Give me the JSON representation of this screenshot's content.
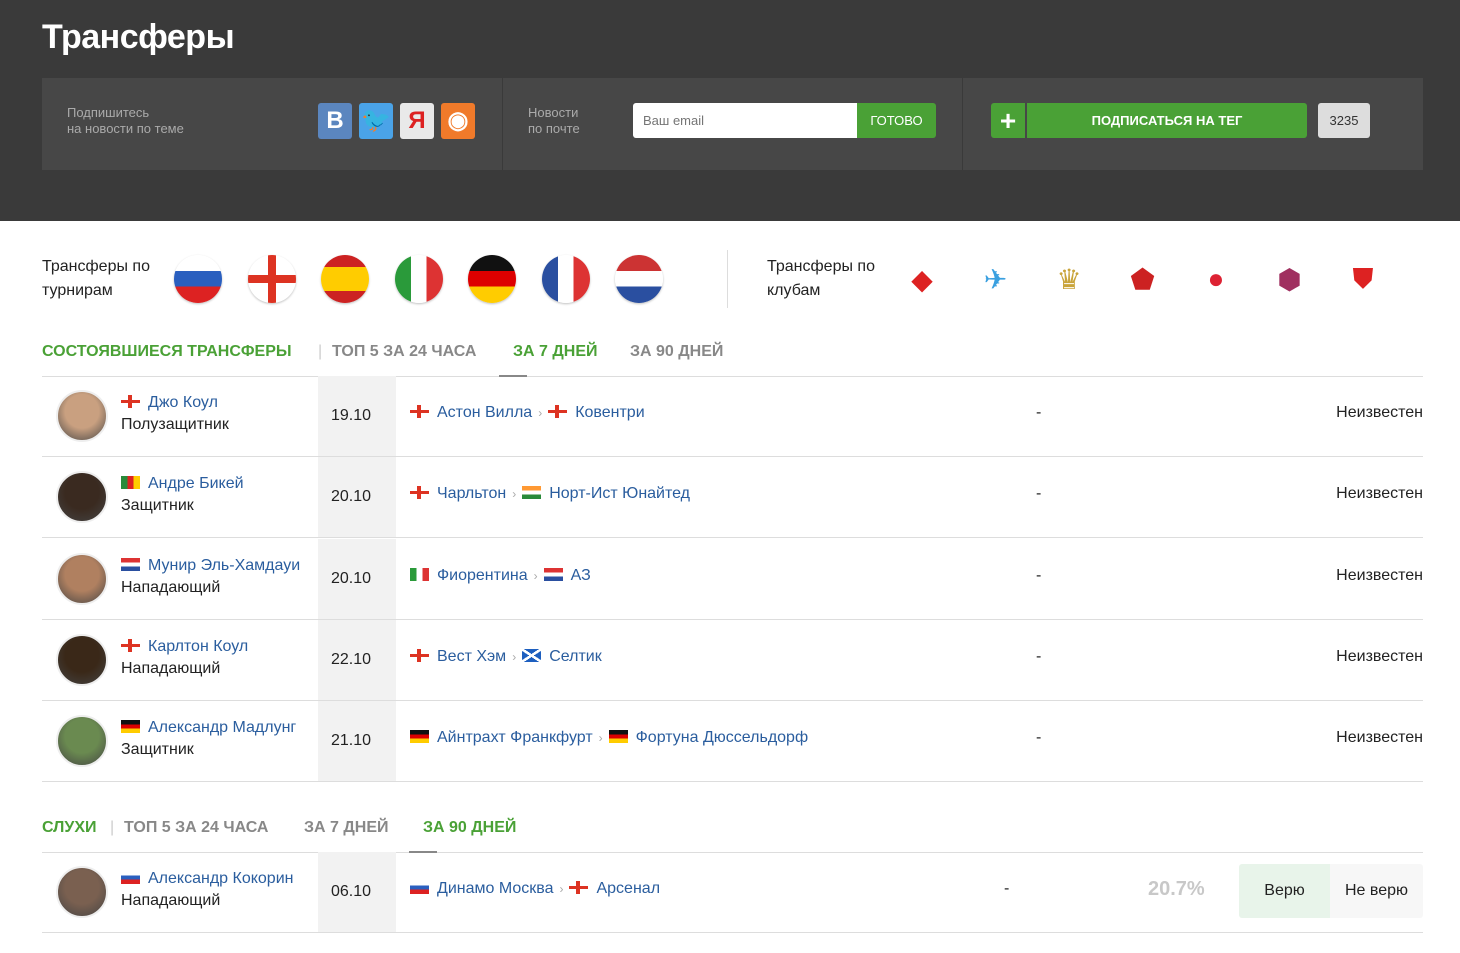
{
  "header": {
    "title": "Трансферы",
    "subscribe_text": "Подпишитесь\nна новости по теме",
    "social": [
      {
        "icon": "vk-icon",
        "label": "B",
        "color": "#5b86bf"
      },
      {
        "icon": "twitter-icon",
        "label": "🐦",
        "color": "#4aa3e8"
      },
      {
        "icon": "yandex-icon",
        "label": "Я",
        "color": "#e9e9e9"
      },
      {
        "icon": "rss-icon",
        "label": "◉",
        "color": "#f07a2a"
      }
    ],
    "mail_text": "Новости\nпо почте",
    "email_placeholder": "Ваш email",
    "go_label": "ГОТОВО",
    "subscribe_tag_label": "ПОДПИСАТЬСЯ НА ТЕГ",
    "subscribers_count": "3235"
  },
  "filters": {
    "tournaments_label": "Трансферы по\nтурнирам",
    "clubs_label": "Трансферы по\nклубам",
    "tournaments": [
      "russia",
      "england",
      "spain",
      "italy",
      "germany",
      "france",
      "netherlands"
    ],
    "clubs": [
      "spartak",
      "zenit",
      "real-madrid",
      "cska",
      "manchester-united",
      "barcelona",
      "arsenal"
    ]
  },
  "done": {
    "tabs": [
      {
        "label": "СОСТОЯВШИЕСЯ ТРАНСФЕРЫ",
        "active": false,
        "green": true
      },
      {
        "label": "ТОП 5 ЗА 24 ЧАСА"
      },
      {
        "label": "ЗА 7 ДНЕЙ",
        "active": true
      },
      {
        "label": "ЗА 90 ДНЕЙ"
      }
    ],
    "rows": [
      {
        "flag": "en",
        "name": "Джо Коул",
        "position": "Полузащитник",
        "date": "19.10",
        "from_flag": "en",
        "from": "Астон Вилла",
        "to_flag": "en",
        "to": "Ковентри",
        "dash": "-",
        "fee": "Неизвестен"
      },
      {
        "flag": "cm",
        "name": "Андре Бикей",
        "position": "Защитник",
        "date": "20.10",
        "from_flag": "en",
        "from": "Чарльтон",
        "to_flag": "in",
        "to": "Норт-Ист Юнайтед",
        "dash": "-",
        "fee": "Неизвестен"
      },
      {
        "flag": "nl",
        "name": "Мунир Эль-Хамдауи",
        "position": "Нападающий",
        "date": "20.10",
        "from_flag": "it",
        "from": "Фиорентина",
        "to_flag": "nl",
        "to": "АЗ",
        "dash": "-",
        "fee": "Неизвестен"
      },
      {
        "flag": "en",
        "name": "Карлтон Коул",
        "position": "Нападающий",
        "date": "22.10",
        "from_flag": "en",
        "from": "Вест Хэм",
        "to_flag": "sc",
        "to": "Селтик",
        "dash": "-",
        "fee": "Неизвестен"
      },
      {
        "flag": "de",
        "name": "Александр Мадлунг",
        "position": "Защитник",
        "date": "21.10",
        "from_flag": "de",
        "from": "Айнтрахт Франкфурт",
        "to_flag": "de",
        "to": "Фортуна Дюссельдорф",
        "dash": "-",
        "fee": "Неизвестен"
      }
    ]
  },
  "rumors": {
    "tabs": [
      {
        "label": "СЛУХИ",
        "green": true
      },
      {
        "label": "ТОП 5 ЗА 24 ЧАСА"
      },
      {
        "label": "ЗА 7 ДНЕЙ"
      },
      {
        "label": "ЗА 90 ДНЕЙ",
        "active": true
      }
    ],
    "rows": [
      {
        "flag": "ru",
        "name": "Александр Кокорин",
        "position": "Нападающий",
        "date": "06.10",
        "from_flag": "ru",
        "from": "Динамо Москва",
        "to_flag": "en",
        "to": "Арсенал",
        "dash": "-",
        "percent": "20.7%",
        "believe": "Верю",
        "not_believe": "Не верю"
      }
    ]
  },
  "colors": {
    "green": "#4aa136",
    "link": "#2a5d9e",
    "header_bg": "#3a3a3a"
  }
}
